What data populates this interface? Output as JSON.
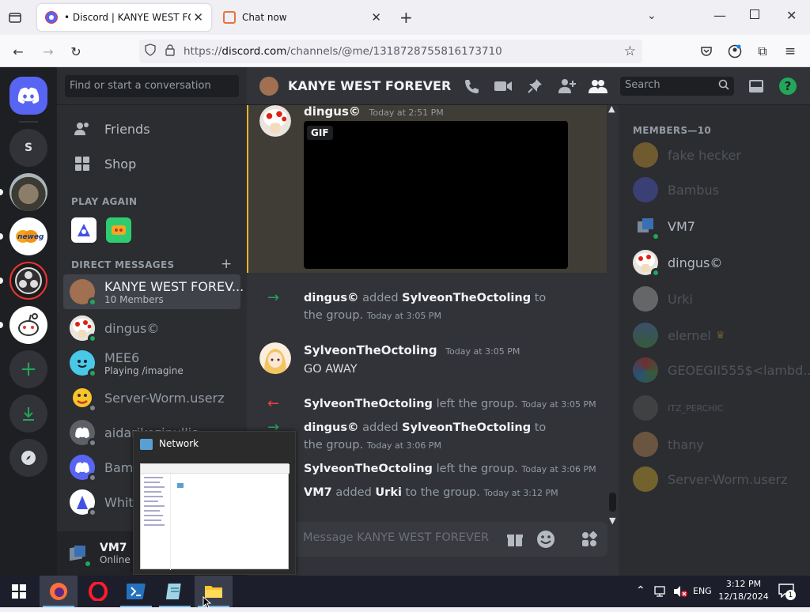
{
  "browser": {
    "tabs": [
      {
        "label": "• Discord | KANYE WEST FOREVER",
        "active": true
      },
      {
        "label": "Chat now",
        "active": false
      }
    ],
    "new_tab_symbol": "+",
    "url_prefix": "https://",
    "url_host": "discord.com",
    "url_path": "/channels/@me/1318728755816173710"
  },
  "servers": [
    {
      "type": "home",
      "icon": "discord-logo-icon"
    },
    {
      "type": "letter",
      "label": "S"
    },
    {
      "type": "image",
      "name": "pug-server"
    },
    {
      "type": "image",
      "name": "newegg-server"
    },
    {
      "type": "image",
      "name": "obs-server"
    },
    {
      "type": "image",
      "name": "reddit-server"
    },
    {
      "type": "action",
      "icon": "add-server-icon",
      "label": "+"
    },
    {
      "type": "action",
      "icon": "download-icon"
    },
    {
      "type": "action",
      "icon": "explore-icon"
    }
  ],
  "dm_sidebar": {
    "search_placeholder": "Find or start a conversation",
    "friends_label": "Friends",
    "shop_label": "Shop",
    "play_again_header": "PLAY AGAIN",
    "direct_messages_header": "DIRECT MESSAGES",
    "add_dm_symbol": "+",
    "dms": [
      {
        "name": "KANYE WEST FOREV...",
        "sub": "10 Members",
        "selected": true,
        "status": "online"
      },
      {
        "name": "dingus©",
        "sub": "",
        "status": "online"
      },
      {
        "name": "MEE6",
        "sub": "Playing /imagine",
        "status": "online"
      },
      {
        "name": "Server-Worm.userz",
        "sub": "",
        "status": "offline"
      },
      {
        "name": "aidarikozjpullis",
        "sub": "",
        "status": "offline"
      },
      {
        "name": "Bambus",
        "sub": "",
        "status": "offline"
      },
      {
        "name": "White",
        "sub": "",
        "status": "offline"
      }
    ],
    "user": {
      "name": "VM7",
      "status": "Online"
    }
  },
  "header": {
    "channel_name": "KANYE WEST FOREVER",
    "search_placeholder": "Search",
    "help_symbol": "?"
  },
  "messages": [
    {
      "author": "dingus©",
      "time": "Today at 2:51 PM",
      "attachment": "GIF"
    },
    {
      "actor": "dingus©",
      "action": "added",
      "target": "SylveonTheOctoling",
      "suffix": "to the group.",
      "time": "Today at 3:05 PM"
    },
    {
      "author": "SylveonTheOctoling",
      "time": "Today at 3:05 PM",
      "text": "GO AWAY"
    },
    {
      "actor": "SylveonTheOctoling",
      "action": "left the group.",
      "time": "Today at 3:05 PM"
    },
    {
      "actor": "dingus©",
      "action": "added",
      "target": "SylveonTheOctoling",
      "suffix": "to the group.",
      "time": "Today at 3:06 PM"
    },
    {
      "actor": "SylveonTheOctoling",
      "action": "left the group.",
      "time": "Today at 3:06 PM"
    },
    {
      "actor": "VM7",
      "action": "added",
      "target": "Urki",
      "suffix": "to the group.",
      "time": "Today at 3:12 PM"
    }
  ],
  "composer": {
    "placeholder": "Message KANYE WEST FOREVER"
  },
  "members": {
    "header": "MEMBERS—10",
    "list": [
      {
        "name": "fake hecker",
        "online": false
      },
      {
        "name": "Bambus",
        "online": false
      },
      {
        "name": "VM7",
        "online": true
      },
      {
        "name": "dingus©",
        "online": true
      },
      {
        "name": "Urki",
        "online": false
      },
      {
        "name": "elernel",
        "online": false,
        "crown": "♛"
      },
      {
        "name": "GEOEGII555$<lambd...",
        "online": false
      },
      {
        "name": "ITZ_PERCHIC",
        "online": false
      },
      {
        "name": "thany",
        "online": false
      },
      {
        "name": "Server-Worm.userz",
        "online": false
      }
    ]
  },
  "taskbar_popup": {
    "title": "Network"
  },
  "taskbar": {
    "language": "ENG",
    "time": "3:12 PM",
    "date": "12/18/2024",
    "notification_count": "1"
  },
  "colors": {
    "discord_blurple": "#5865f2",
    "online_green": "#23a55a",
    "background": "#313338"
  }
}
